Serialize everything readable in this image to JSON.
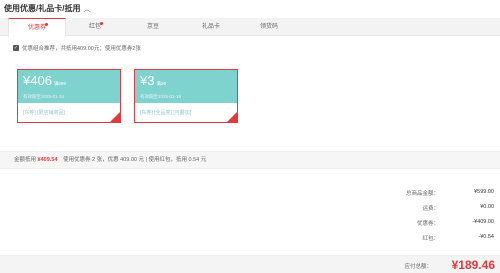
{
  "header": {
    "title": "使用优惠/礼品卡/抵用",
    "chevron_icon": "chevron-up-icon"
  },
  "tabs": [
    {
      "label": "优惠券",
      "active": true,
      "dot": true
    },
    {
      "label": "红包",
      "active": false,
      "dot": true
    },
    {
      "label": "京豆",
      "active": false,
      "dot": false
    },
    {
      "label": "礼品卡",
      "active": false,
      "dot": false
    },
    {
      "label": "领货码",
      "active": false,
      "dot": false
    }
  ],
  "combo": {
    "text": "优惠组合推荐，共抵用409.00元；使用优惠券2张",
    "checked": true
  },
  "coupons": [
    {
      "amount": "¥406",
      "condition": "满699",
      "valid": "有效期至2025-01-24",
      "tags": "[东券] [限店铺商品]"
    },
    {
      "amount": "¥3",
      "condition": "满29",
      "valid": "有效期至2025-01-18",
      "tags": "[东券] [全品类] [可叠加]"
    }
  ],
  "deduction": {
    "label": "金额抵用",
    "amount": "¥409.54",
    "detail": "使用优惠券 2 张，优惠 409.00 元 | 使用红包，抵用 0.54 元"
  },
  "summary": [
    {
      "label": "总商品金额：",
      "value": "¥599.00"
    },
    {
      "label": "运费：",
      "value": "¥0.00"
    },
    {
      "label": "优惠券：",
      "value": "-¥409.00"
    },
    {
      "label": "红包：",
      "value": "-¥0.54"
    }
  ],
  "payable": {
    "label": "应付总额：",
    "value": "¥189.46"
  },
  "colors": {
    "accent": "#e4393c",
    "coupon_bg": "#7fd3cf"
  }
}
